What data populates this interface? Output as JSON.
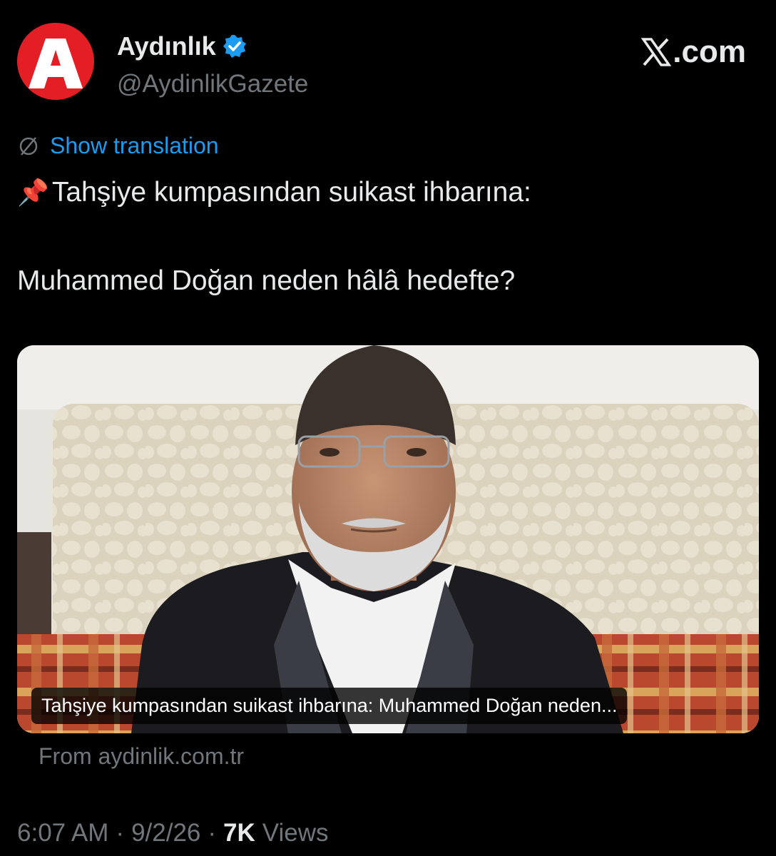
{
  "account": {
    "display_name": "Aydınlık",
    "handle": "@AydinlikGazete",
    "avatar_letter": "A",
    "avatar_color": "#e31e24",
    "verified_color": "#1d9bf0"
  },
  "source_brand": ".com",
  "translation": {
    "icon": "globe-icon",
    "label": "Show translation"
  },
  "tweet": {
    "pin_emoji": "📌",
    "line1": "Tahşiye kumpasından suikast ihbarına:",
    "line2": "Muhammed Doğan neden hâlâ hedefte?"
  },
  "link_card": {
    "image": "photo-of-elderly-man",
    "caption": "Tahşiye kumpasından suikast ihbarına: Muhammed Doğan neden...",
    "from": "From aydinlik.com.tr"
  },
  "meta": {
    "time": "6:07 AM",
    "separator": "·",
    "date": "9/2/26",
    "views_count": "7K",
    "views_label": "Views"
  },
  "colors": {
    "background": "#000000",
    "text": "#e7e9ea",
    "secondary": "#71767b",
    "link": "#1d9bf0"
  }
}
